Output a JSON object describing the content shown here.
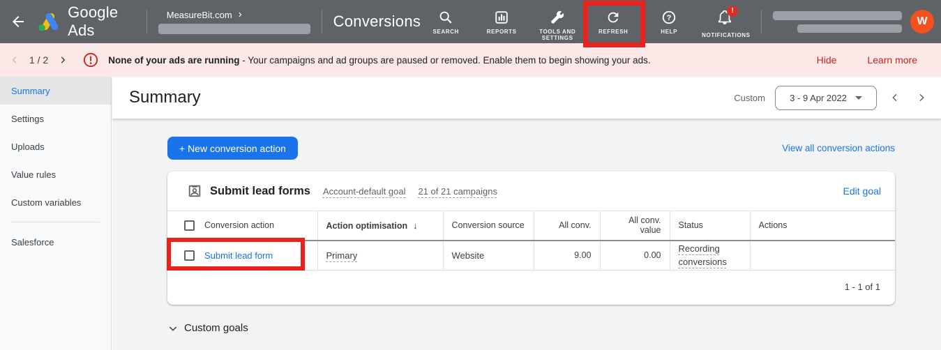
{
  "topbar": {
    "brand": "Google Ads",
    "account_name": "MeasureBit.com",
    "section_title": "Conversions",
    "nav": [
      {
        "label": "SEARCH"
      },
      {
        "label": "REPORTS"
      },
      {
        "label": "TOOLS AND SETTINGS",
        "highlighted": true
      },
      {
        "label": "REFRESH"
      },
      {
        "label": "HELP"
      },
      {
        "label": "NOTIFICATIONS",
        "badge": "!"
      }
    ],
    "notification_badge": "!",
    "avatar_initial": "W"
  },
  "banner": {
    "pager": "1 / 2",
    "title": "None of your ads are running",
    "message": " - Your campaigns and ad groups are paused or removed. Enable them to begin showing your ads.",
    "hide_label": "Hide",
    "learn_more_label": "Learn more"
  },
  "sidebar": {
    "items": [
      {
        "label": "Summary",
        "selected": true
      },
      {
        "label": "Settings"
      },
      {
        "label": "Uploads"
      },
      {
        "label": "Value rules"
      },
      {
        "label": "Custom variables"
      },
      {
        "label": "Salesforce"
      }
    ]
  },
  "main": {
    "title": "Summary",
    "date_label": "Custom",
    "date_value": "3 - 9 Apr 2022",
    "new_action_button": "+ New conversion action",
    "view_all_link": "View all conversion actions",
    "goal_card": {
      "title": "Submit lead forms",
      "meta_goal_type": "Account-default goal",
      "meta_campaigns": "21 of 21 campaigns",
      "edit_link": "Edit goal",
      "columns": [
        "Conversion action",
        "Action optimisation",
        "Conversion source",
        "All conv.",
        "All conv. value",
        "Status",
        "Actions"
      ],
      "rows": [
        {
          "action": "Submit lead form",
          "optimisation": "Primary",
          "source": "Website",
          "all_conv": "9.00",
          "all_conv_value": "0.00",
          "status": "Recording conversions",
          "actions": ""
        }
      ],
      "pagination": "1 - 1 of 1"
    },
    "custom_goals_label": "Custom goals"
  },
  "icons": {
    "sort_desc": "↓"
  },
  "colors": {
    "topbar_bg": "#5f6368",
    "accent_blue": "#1a73e8",
    "banner_bg": "#fce8e6",
    "banner_red": "#c5221f",
    "highlight_red": "#e8231d",
    "avatar_bg": "#f4511e"
  }
}
